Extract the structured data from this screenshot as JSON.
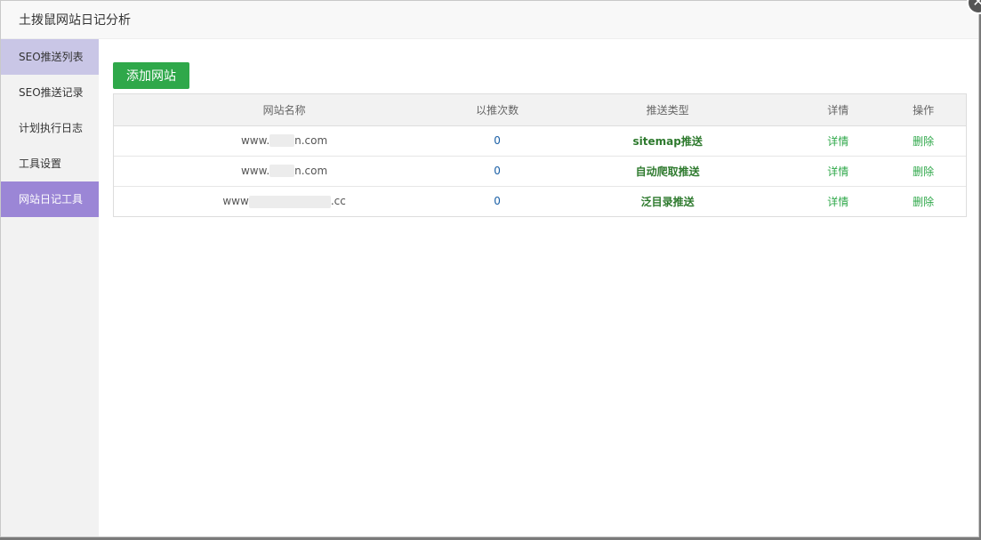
{
  "window": {
    "title": "土拨鼠网站日记分析",
    "close_glyph": "✕"
  },
  "sidebar": {
    "items": [
      {
        "label": "SEO推送列表"
      },
      {
        "label": "SEO推送记录"
      },
      {
        "label": "计划执行日志"
      },
      {
        "label": "工具设置"
      },
      {
        "label": "网站日记工具"
      }
    ]
  },
  "toolbar": {
    "add_label": "添加网站"
  },
  "table": {
    "headers": [
      "网站名称",
      "以推次数",
      "推送类型",
      "详情",
      "操作"
    ],
    "rows": [
      {
        "name_prefix": "www.",
        "name_suffix": "n.com",
        "count": "0",
        "type": "sitemap推送",
        "detail": "详情",
        "action": "删除"
      },
      {
        "name_prefix": "www.",
        "name_suffix": "n.com",
        "count": "0",
        "type": "自动爬取推送",
        "detail": "详情",
        "action": "删除"
      },
      {
        "name_prefix": "www",
        "name_suffix": ".cc",
        "count": "0",
        "type": "泛目录推送",
        "detail": "详情",
        "action": "删除"
      }
    ]
  }
}
